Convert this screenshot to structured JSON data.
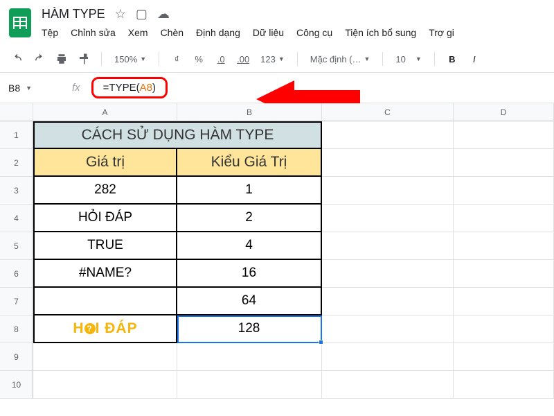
{
  "doc": {
    "title": "HÀM TYPE"
  },
  "title_icons": {
    "star": "☆",
    "move": "▢",
    "cloud": "☁"
  },
  "menu": {
    "file": "Tệp",
    "edit": "Chỉnh sửa",
    "view": "Xem",
    "insert": "Chèn",
    "format": "Định dạng",
    "data": "Dữ liệu",
    "tools": "Công cụ",
    "addons": "Tiện ích bổ sung",
    "help": "Trợ gi"
  },
  "toolbar": {
    "zoom": "150%",
    "currency": "₫",
    "percent": "%",
    "dec_dec": ".0",
    "inc_dec": ".00",
    "numfmt": "123",
    "font": "Mặc định (…",
    "size": "10",
    "bold": "B",
    "italic": "I"
  },
  "formula": {
    "cell_ref": "B8",
    "fx": "fx",
    "prefix": "=TYPE(",
    "ref": "A8",
    "suffix": ")"
  },
  "cols": {
    "A": "A",
    "B": "B",
    "C": "C",
    "D": "D"
  },
  "rows": [
    "1",
    "2",
    "3",
    "4",
    "5",
    "6",
    "7",
    "8",
    "9",
    "10"
  ],
  "sheet": {
    "title": "CÁCH SỬ DỤNG HÀM TYPE",
    "h1": "Giá trị",
    "h2": "Kiểu Giá Trị",
    "a3": "282",
    "b3": "1",
    "a4": "HỎI ĐÁP",
    "b4": "2",
    "a5": "TRUE",
    "b5": "4",
    "a6": "#NAME?",
    "b6": "16",
    "a7": "",
    "b7": "64",
    "a8_brand_a": "H",
    "a8_brand_b": "I ĐÁP",
    "b8": "128"
  }
}
